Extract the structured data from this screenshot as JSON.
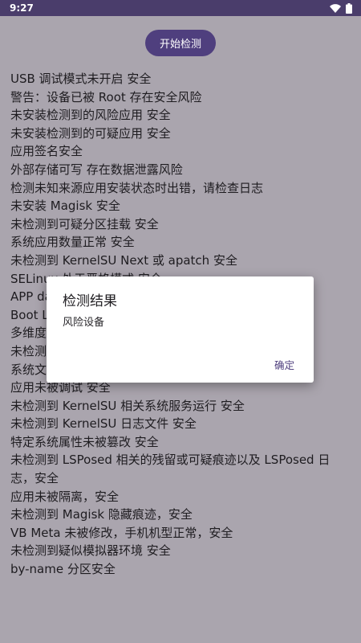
{
  "status_bar": {
    "time": "9:27",
    "icons": [
      "wifi-icon",
      "battery-icon"
    ],
    "color": "#4a3d6b"
  },
  "actions": {
    "start_button": "开始检测",
    "accent_color": "#4f3f7e"
  },
  "results": [
    "USB 调试模式未开启 安全",
    "警告：设备已被 Root 存在安全风险",
    "未安装检测到的风险应用 安全",
    "未安装检测到的可疑应用 安全",
    "应用签名安全",
    "外部存储可写 存在数据泄露风险",
    "检测未知来源应用安装状态时出错，请检查日志",
    "未安装 Magisk 安全",
    "未检测到可疑分区挂载 安全",
    "系统应用数量正常 安全",
    "未检测到 KernelSU Next 或 apatch 安全",
    "SELinux 处于严格模式 安全",
    "APP da",
    "Boot Lo",
    "多维度",
    "未检测",
    "系统文",
    "应用未被调试 安全",
    "未检测到 KernelSU 相关系统服务运行 安全",
    "未检测到 KernelSU 日志文件 安全",
    "特定系统属性未被篡改 安全",
    "未检测到 LSPosed 相关的残留或可疑痕迹以及 LSPosed 日志，安全",
    "应用未被隔离，安全",
    "未检测到 Magisk 隐藏痕迹，安全",
    "VB Meta 未被修改，手机机型正常，安全",
    "未检测到疑似模拟器环境 安全",
    "by-name 分区安全"
  ],
  "dialog": {
    "title": "检测结果",
    "message": "风险设备",
    "confirm": "确定"
  }
}
